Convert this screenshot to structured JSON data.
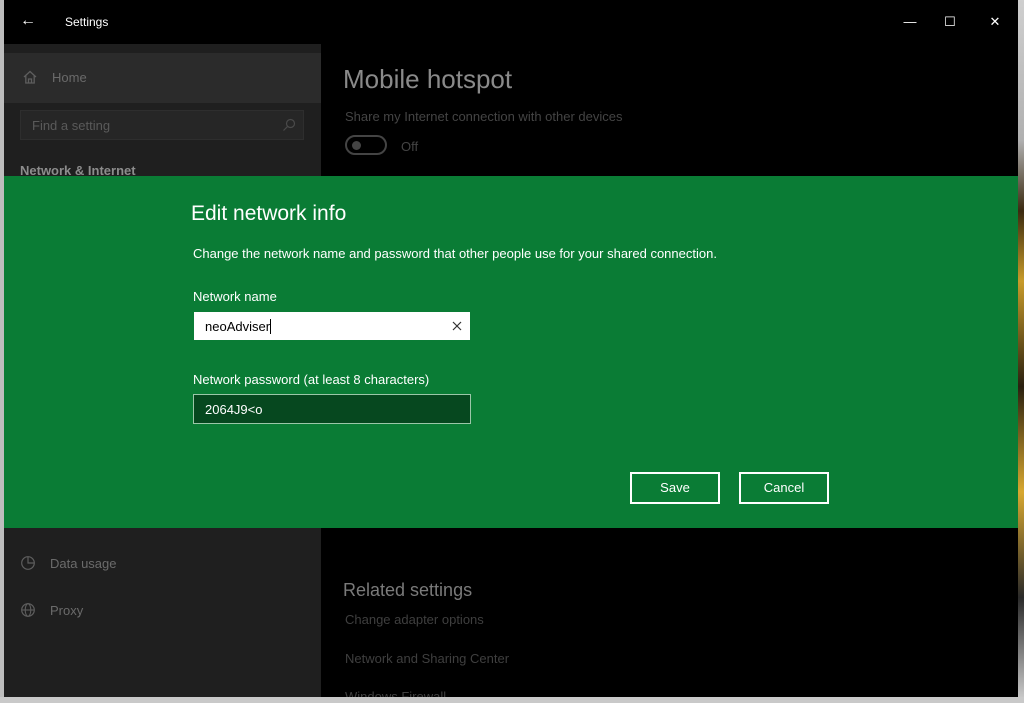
{
  "window": {
    "title": "Settings",
    "controls": {
      "minimize": "—",
      "maximize": "☐",
      "close": "✕"
    },
    "back_glyph": "←"
  },
  "sidebar": {
    "home": {
      "label": "Home",
      "icon": "home-icon"
    },
    "search": {
      "placeholder": "Find a setting",
      "icon": "search-icon"
    },
    "section_title": "Network & Internet",
    "items": [
      {
        "label": "Data usage",
        "icon": "data-usage-icon"
      },
      {
        "label": "Proxy",
        "icon": "globe-icon"
      }
    ]
  },
  "main": {
    "title": "Mobile hotspot",
    "share_label": "Share my Internet connection with other devices",
    "toggle_state": "Off",
    "toggle_on": false,
    "related": {
      "title": "Related settings",
      "links": [
        "Change adapter options",
        "Network and Sharing Center",
        "Windows Firewall"
      ]
    }
  },
  "dialog": {
    "title": "Edit network info",
    "description": "Change the network name and password that other people use for your shared connection.",
    "name_label": "Network name",
    "name_value": "neoAdviser",
    "password_label": "Network password (at least 8 characters)",
    "password_value": "2064J9<o",
    "save_label": "Save",
    "cancel_label": "Cancel"
  },
  "colors": {
    "dialog_bg": "#0a7c35",
    "sidebar_bg": "#1f1f1f",
    "main_bg": "#000000",
    "password_field_bg": "#06481f"
  }
}
